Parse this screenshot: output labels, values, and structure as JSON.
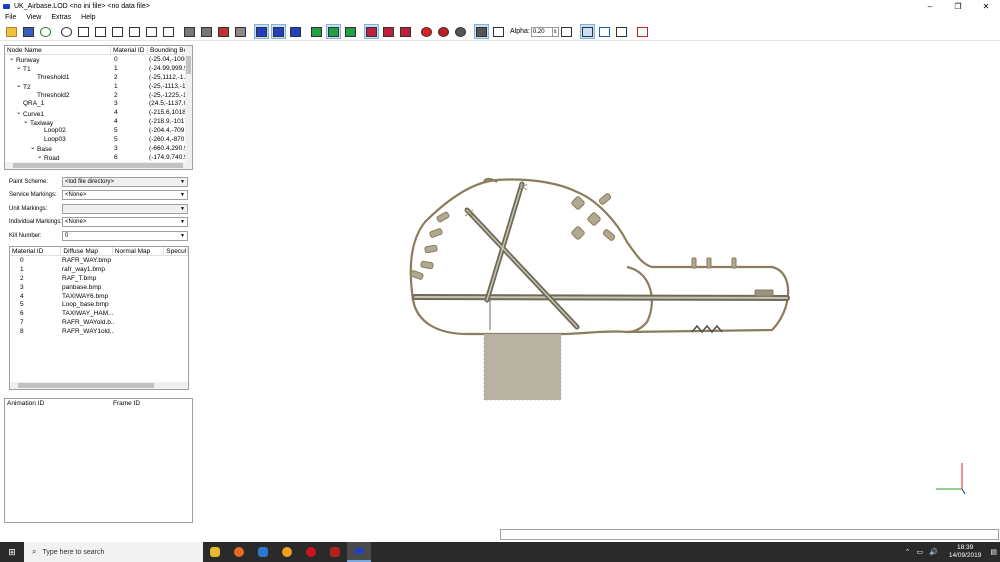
{
  "window": {
    "title": "UK_Airbase.LOD  <no ini file>  <no data file>"
  },
  "window_controls": {
    "minimize": "–",
    "maximize": "❐",
    "close": "✕"
  },
  "menu": [
    "File",
    "View",
    "Extras",
    "Help"
  ],
  "toolbar": {
    "alpha_label": "Alpha:",
    "alpha_value": "0.20"
  },
  "tree": {
    "headers": [
      "Node Name",
      "Material ID",
      "Bounding Bo"
    ],
    "rows": [
      {
        "toggle": "⌄",
        "name": "Runway",
        "indent": 0,
        "mat": "0",
        "bb": "(-25.04,-1000."
      },
      {
        "toggle": "⌄",
        "name": "T1",
        "indent": 1,
        "mat": "1",
        "bb": "(-24.99,999.9,"
      },
      {
        "toggle": "",
        "name": "Threshold1",
        "indent": 3,
        "mat": "2",
        "bb": "(-25,1112,-1."
      },
      {
        "toggle": "⌄",
        "name": "T2",
        "indent": 1,
        "mat": "1",
        "bb": "(-25,-1113,-1."
      },
      {
        "toggle": "",
        "name": "Threshold2",
        "indent": 3,
        "mat": "2",
        "bb": "(-25,-1225,-1."
      },
      {
        "toggle": "",
        "name": "QRA_1",
        "indent": 1,
        "mat": "3",
        "bb": "(24.5,-1137,0."
      },
      {
        "toggle": "⌄",
        "name": "Curve1",
        "indent": 1,
        "mat": "4",
        "bb": "(-215.6,1018,-"
      },
      {
        "toggle": "⌄",
        "name": "Taxiway",
        "indent": 2,
        "mat": "4",
        "bb": "(-218.9,-1017,"
      },
      {
        "toggle": "",
        "name": "Loop02",
        "indent": 4,
        "mat": "5",
        "bb": "(-204.4,-709.4"
      },
      {
        "toggle": "",
        "name": "Loop03",
        "indent": 4,
        "mat": "5",
        "bb": "(-260.4,-870.7"
      },
      {
        "toggle": "⌄",
        "name": "Base",
        "indent": 3,
        "mat": "3",
        "bb": "(-660.4,290.9,"
      },
      {
        "toggle": "⌄",
        "name": "Road",
        "indent": 4,
        "mat": "6",
        "bb": "(-174.9,740.9"
      }
    ]
  },
  "props": [
    {
      "label": "Paint Scheme:",
      "value": "<lod file directory>",
      "grey": true
    },
    {
      "label": "Service Markings:",
      "value": "<None>",
      "grey": false
    },
    {
      "label": "Unit Markings:",
      "value": "",
      "grey": true
    },
    {
      "label": "Individual Markings:",
      "value": "<None>",
      "grey": false
    },
    {
      "label": "Kill Number:",
      "value": "0",
      "grey": false
    }
  ],
  "materials": {
    "headers": [
      "Material ID",
      "Diffuse Map",
      "Normal Map",
      "Specul"
    ],
    "rows": [
      {
        "id": "0",
        "diffuse": "RAFR_WAY.bmp"
      },
      {
        "id": "1",
        "diffuse": "rafr_way1.bmp"
      },
      {
        "id": "2",
        "diffuse": "RAF_T.bmp"
      },
      {
        "id": "3",
        "diffuse": "panbase.bmp"
      },
      {
        "id": "4",
        "diffuse": "TAXIWAY6.bmp"
      },
      {
        "id": "5",
        "diffuse": "Loop_base.bmp"
      },
      {
        "id": "6",
        "diffuse": "TAXIWAY_HAM..."
      },
      {
        "id": "7",
        "diffuse": "RAFR_WAYold.b..."
      },
      {
        "id": "8",
        "diffuse": "RAFR_WAY1old...."
      }
    ]
  },
  "animation": {
    "headers": [
      "Animation ID",
      "Frame ID"
    ]
  },
  "taskbar": {
    "search_placeholder": "Type here to search",
    "time": "18:39",
    "date": "14/09/2019"
  },
  "colors": {
    "track": "#8a7d5c",
    "pad": "#b0a890",
    "axis_red": "#e02020",
    "axis_green": "#20a020"
  }
}
